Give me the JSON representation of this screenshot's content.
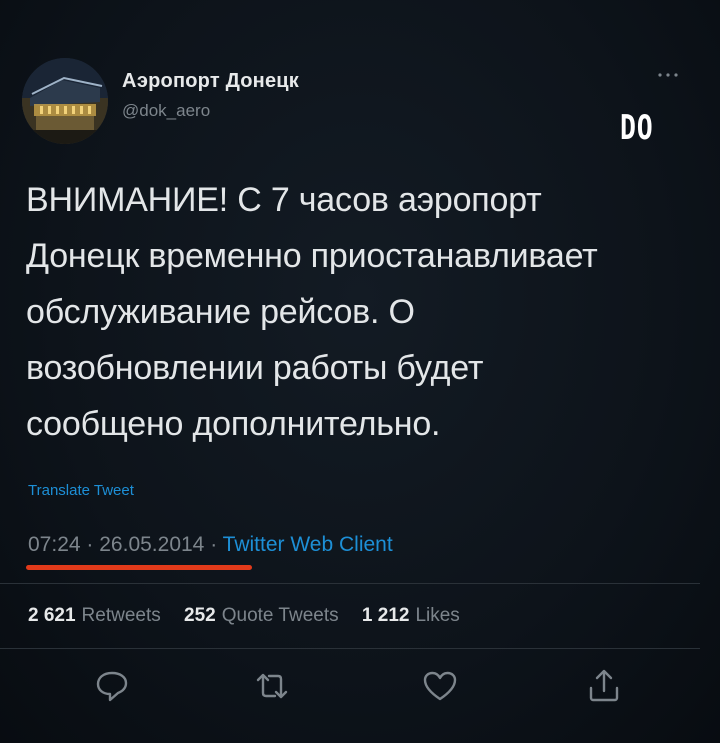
{
  "account": {
    "display_name": "Аэропорт Донецк",
    "handle": "@dok_aero"
  },
  "overlay": {
    "watermark": "DO"
  },
  "tweet": {
    "lines": [
      "ВНИМАНИЕ! С 7 часов аэропорт",
      "Донецк временно приостанавливает",
      "обслуживание рейсов. О",
      "возобновлении работы будет",
      "сообщено дополнительно."
    ],
    "translate_label": "Translate Tweet",
    "time": "07:24",
    "date": "26.05.2014",
    "separator": "·",
    "client": "Twitter Web Client"
  },
  "stats": {
    "retweets_count": "2 621",
    "retweets_label": "Retweets",
    "quotes_count": "252",
    "quotes_label": "Quote Tweets",
    "likes_count": "1 212",
    "likes_label": "Likes"
  },
  "icons": {
    "more": "more-icon",
    "reply": "reply-icon",
    "retweet": "retweet-icon",
    "like": "like-icon",
    "share": "share-icon"
  },
  "colors": {
    "background": "#0b1016",
    "link": "#1d8fd6",
    "muted": "#7d858c",
    "text": "#e3e6e8",
    "highlight_underline": "#e23a1a"
  }
}
